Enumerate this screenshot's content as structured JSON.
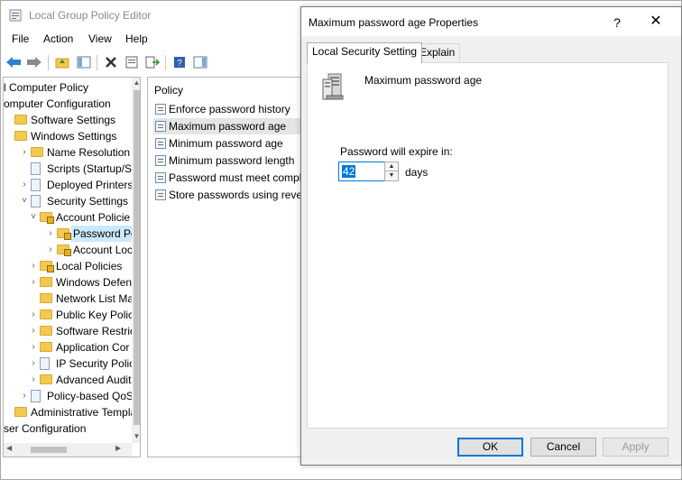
{
  "main_window": {
    "title": "Local Group Policy Editor",
    "menu": [
      "File",
      "Action",
      "View",
      "Help"
    ]
  },
  "tree": {
    "items": [
      {
        "label": "l Computer Policy",
        "arrow": "",
        "icon": "none"
      },
      {
        "label": "omputer Configuration",
        "arrow": "",
        "icon": "none"
      },
      {
        "label": "Software Settings",
        "arrow": "",
        "icon": "folder"
      },
      {
        "label": "Windows Settings",
        "arrow": "",
        "icon": "folder"
      },
      {
        "label": "Name Resolution P",
        "arrow": "›",
        "icon": "folder"
      },
      {
        "label": "Scripts (Startup/Shu",
        "arrow": "",
        "icon": "doc"
      },
      {
        "label": "Deployed Printers",
        "arrow": "›",
        "icon": "doc"
      },
      {
        "label": "Security Settings",
        "arrow": "˅",
        "icon": "doc"
      },
      {
        "label": "Account Policie",
        "arrow": "˅",
        "icon": "folder-lock"
      },
      {
        "label": "Password Po",
        "arrow": "›",
        "icon": "folder-lock",
        "selected": true
      },
      {
        "label": "Account Loc",
        "arrow": "›",
        "icon": "folder-lock"
      },
      {
        "label": "Local Policies",
        "arrow": "›",
        "icon": "folder-lock"
      },
      {
        "label": "Windows Defen",
        "arrow": "›",
        "icon": "folder"
      },
      {
        "label": "Network List Ma",
        "arrow": "",
        "icon": "folder"
      },
      {
        "label": "Public Key Polic",
        "arrow": "›",
        "icon": "folder"
      },
      {
        "label": "Software Restric",
        "arrow": "›",
        "icon": "folder"
      },
      {
        "label": "Application Cor",
        "arrow": "›",
        "icon": "folder"
      },
      {
        "label": "IP Security Polic",
        "arrow": "›",
        "icon": "doc"
      },
      {
        "label": "Advanced Audit",
        "arrow": "›",
        "icon": "folder"
      },
      {
        "label": "Policy-based QoS",
        "arrow": "›",
        "icon": "doc"
      },
      {
        "label": "Administrative Templat",
        "arrow": "",
        "icon": "folder"
      },
      {
        "label": "ser Configuration",
        "arrow": "",
        "icon": "none"
      }
    ]
  },
  "list_pane": {
    "header": "Policy",
    "items": [
      {
        "label": "Enforce password history"
      },
      {
        "label": "Maximum password age",
        "selected": true
      },
      {
        "label": "Minimum password age"
      },
      {
        "label": "Minimum password length"
      },
      {
        "label": "Password must meet comple"
      },
      {
        "label": "Store passwords using revers"
      }
    ]
  },
  "dialog": {
    "title": "Maximum password age Properties",
    "help_glyph": "?",
    "close_glyph": "✕",
    "tabs": [
      "Local Security Setting",
      "Explain"
    ],
    "policy_name": "Maximum password age",
    "expire_label": "Password will expire in:",
    "expire_value": "42",
    "days_label": "days",
    "buttons": {
      "ok": "OK",
      "cancel": "Cancel",
      "apply": "Apply"
    }
  },
  "colors": {
    "accent": "#0078d7",
    "selection": "#cce8ff",
    "folder": "#f3c94f"
  }
}
